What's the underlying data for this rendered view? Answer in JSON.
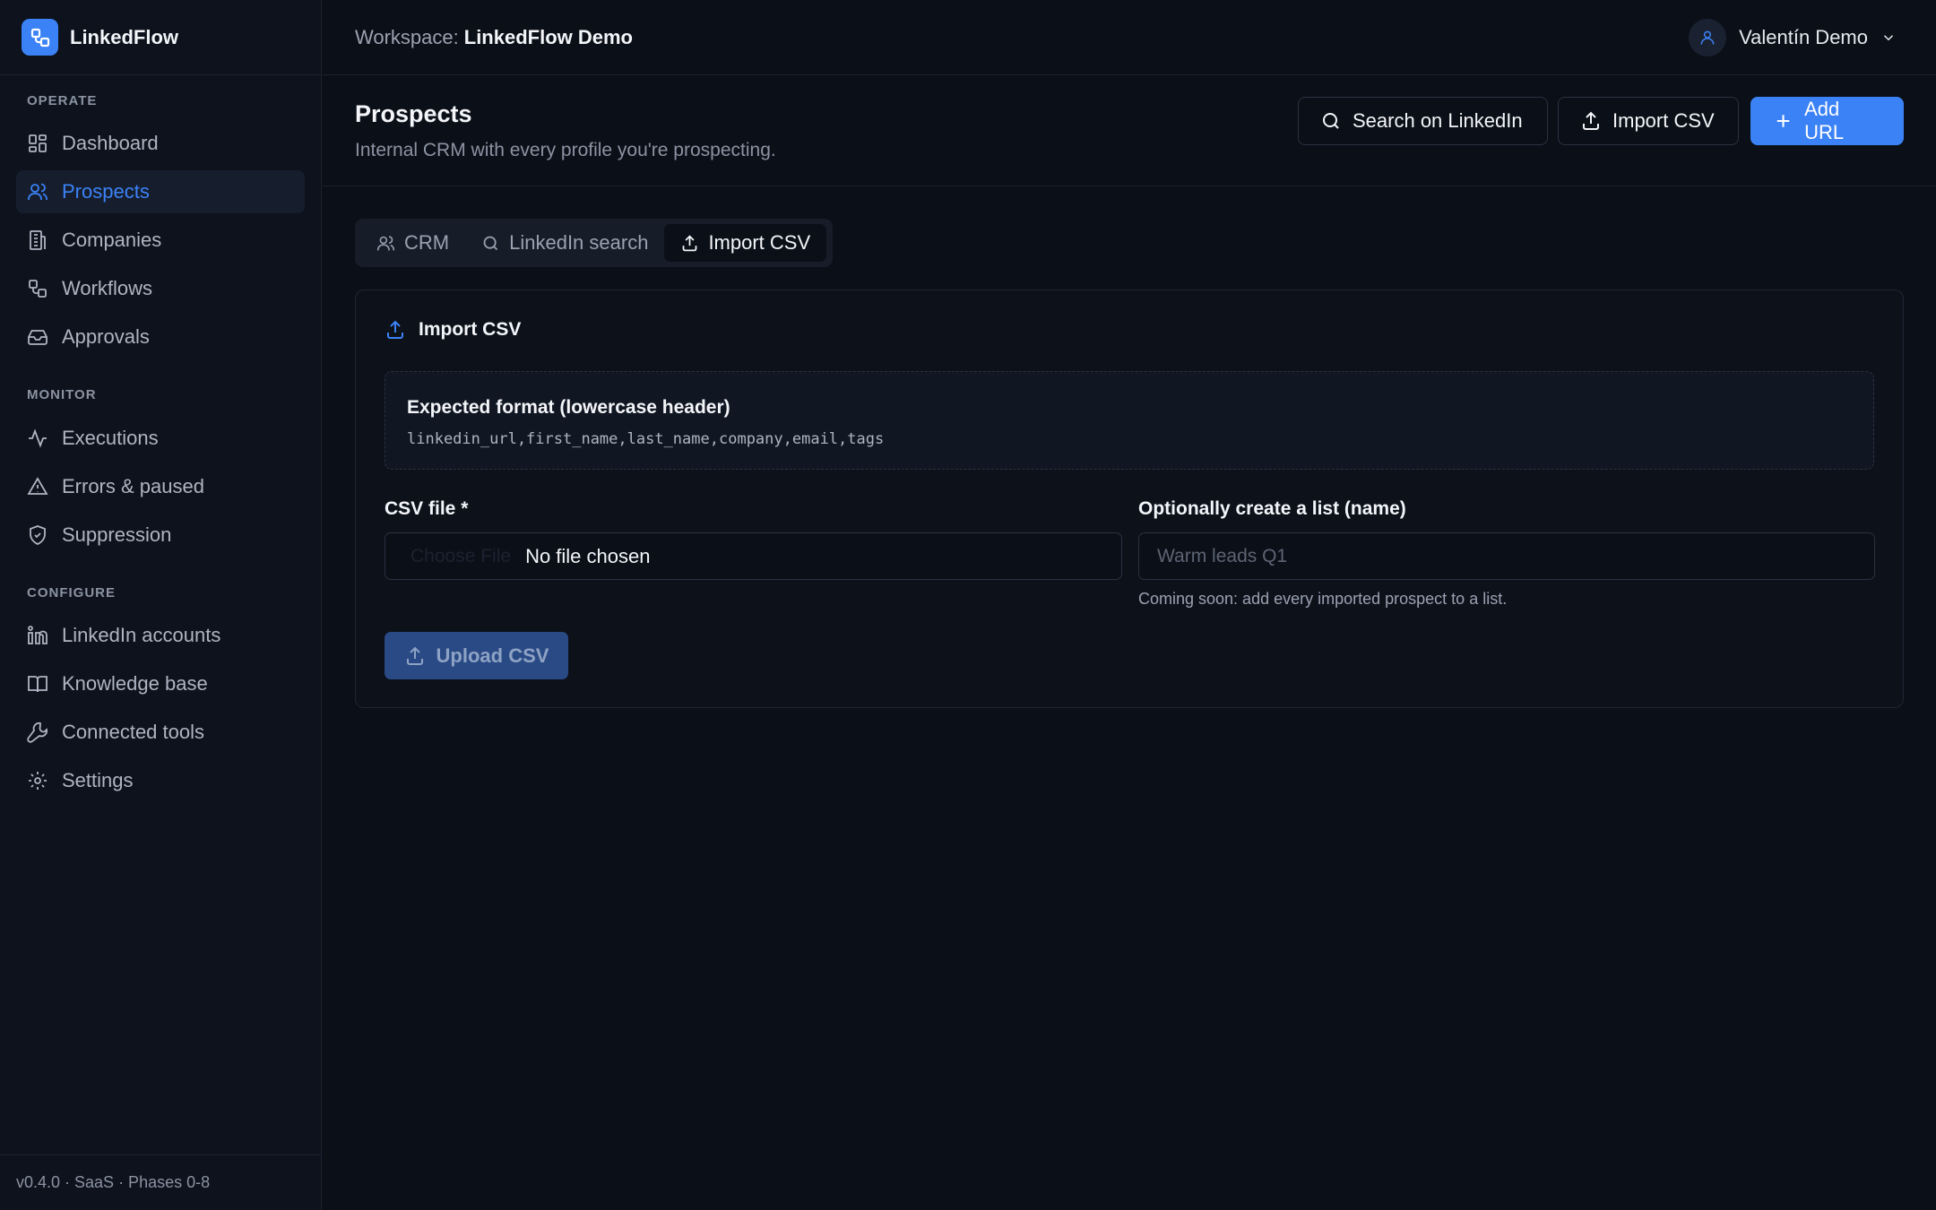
{
  "brand": {
    "name": "LinkedFlow"
  },
  "sidebar": {
    "sections": [
      {
        "label": "OPERATE"
      },
      {
        "label": "MONITOR"
      },
      {
        "label": "CONFIGURE"
      }
    ],
    "items": [
      {
        "label": "Dashboard",
        "icon": "dashboard-icon"
      },
      {
        "label": "Prospects",
        "icon": "users-icon",
        "active": true
      },
      {
        "label": "Companies",
        "icon": "building-icon"
      },
      {
        "label": "Workflows",
        "icon": "workflow-icon"
      },
      {
        "label": "Approvals",
        "icon": "inbox-icon"
      },
      {
        "label": "Executions",
        "icon": "activity-icon"
      },
      {
        "label": "Errors & paused",
        "icon": "warning-icon"
      },
      {
        "label": "Suppression",
        "icon": "shield-icon"
      },
      {
        "label": "LinkedIn accounts",
        "icon": "linkedin-icon"
      },
      {
        "label": "Knowledge base",
        "icon": "book-icon"
      },
      {
        "label": "Connected tools",
        "icon": "wrench-icon"
      },
      {
        "label": "Settings",
        "icon": "gear-icon"
      }
    ],
    "footer": "v0.4.0 · SaaS · Phases 0-8"
  },
  "topbar": {
    "workspace_label": "Workspace:",
    "workspace_name": "LinkedFlow Demo",
    "user_name": "Valentín Demo"
  },
  "page": {
    "title": "Prospects",
    "subtitle": "Internal CRM with every profile you're prospecting.",
    "actions": {
      "search": "Search on LinkedIn",
      "import": "Import CSV",
      "add": "Add URL"
    }
  },
  "tabs": [
    {
      "label": "CRM"
    },
    {
      "label": "LinkedIn search"
    },
    {
      "label": "Import CSV",
      "active": true
    }
  ],
  "import_card": {
    "title": "Import CSV",
    "format_title": "Expected format (lowercase header)",
    "format_code": "linkedin_url,first_name,last_name,company,email,tags",
    "csv_label": "CSV file *",
    "choose_file": "Choose File",
    "no_file": "No file chosen",
    "list_label": "Optionally create a list (name)",
    "list_placeholder": "Warm leads Q1",
    "list_hint": "Coming soon: add every imported prospect to a list.",
    "upload_label": "Upload CSV"
  },
  "colors": {
    "accent": "#3b82f6",
    "background": "#0b0f17",
    "sidebar": "#0d121c"
  }
}
